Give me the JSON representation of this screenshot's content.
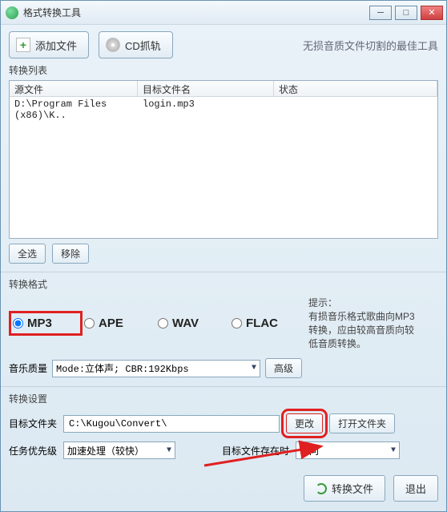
{
  "window": {
    "title": "格式转换工具"
  },
  "toolbar": {
    "add_file": "添加文件",
    "cd_rip": "CD抓轨",
    "tagline": "无损音质文件切割的最佳工具"
  },
  "list": {
    "label": "转换列表",
    "headers": {
      "source": "源文件",
      "target": "目标文件名",
      "status": "状态"
    },
    "rows": [
      {
        "source": "D:\\Program Files (x86)\\K..",
        "target": "login.mp3",
        "status": ""
      }
    ],
    "select_all": "全选",
    "remove": "移除"
  },
  "format": {
    "label": "转换格式",
    "options": {
      "mp3": "MP3",
      "ape": "APE",
      "wav": "WAV",
      "flac": "FLAC"
    },
    "selected": "mp3",
    "tip_title": "提示：",
    "tip_body": "有损音乐格式歌曲向MP3转换，应由较高音质向较低音质转换。",
    "quality_label": "音乐质量",
    "quality_value": "Mode:立体声; CBR:192Kbps",
    "advanced": "高级"
  },
  "settings": {
    "label": "转换设置",
    "dest_label": "目标文件夹",
    "dest_value": "C:\\Kugou\\Convert\\",
    "change": "更改",
    "open_folder": "打开文件夹",
    "priority_label": "任务优先级",
    "priority_value": "加速处理（较快）",
    "exists_label": "目标文件存在时",
    "exists_value": "询问"
  },
  "footer": {
    "convert": "转换文件",
    "exit": "退出"
  }
}
